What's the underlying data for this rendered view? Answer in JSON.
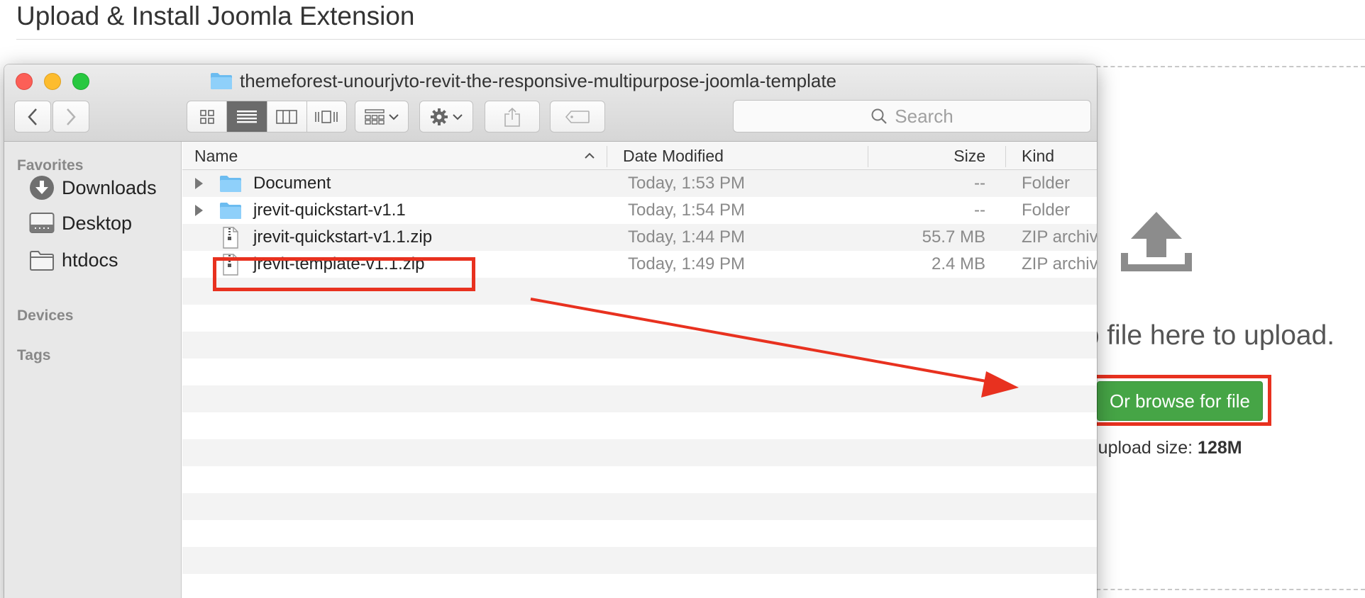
{
  "page": {
    "title": "Upload & Install Joomla Extension",
    "drop_text": "op file here to upload.",
    "browse_label": "Or browse for file",
    "max_upload_prefix": "um upload size: ",
    "max_upload_value": "128M",
    "browse_color": "#46a546"
  },
  "finder": {
    "window_title": "themeforest-unourjvto-revit-the-responsive-multipurpose-joomla-template",
    "search_placeholder": "Search",
    "sidebar": {
      "favorites_heading": "Favorites",
      "items": [
        {
          "label": "Downloads",
          "icon": "downloads-icon"
        },
        {
          "label": "Desktop",
          "icon": "desktop-icon"
        },
        {
          "label": "htdocs",
          "icon": "folder-icon"
        }
      ],
      "devices_heading": "Devices",
      "tags_heading": "Tags"
    },
    "columns": {
      "name": "Name",
      "date": "Date Modified",
      "size": "Size",
      "kind": "Kind"
    },
    "files": [
      {
        "name": "Document",
        "date": "Today, 1:53 PM",
        "size": "--",
        "kind": "Folder",
        "type": "folder"
      },
      {
        "name": "jrevit-quickstart-v1.1",
        "date": "Today, 1:54 PM",
        "size": "--",
        "kind": "Folder",
        "type": "folder"
      },
      {
        "name": "jrevit-quickstart-v1.1.zip",
        "date": "Today, 1:44 PM",
        "size": "55.7 MB",
        "kind": "ZIP archiv",
        "type": "zip"
      },
      {
        "name": "jrevit-template-v1.1.zip",
        "date": "Today, 1:49 PM",
        "size": "2.4 MB",
        "kind": "ZIP archiv",
        "type": "zip"
      }
    ]
  },
  "annotation": {
    "highlight_color": "#e8311f"
  }
}
